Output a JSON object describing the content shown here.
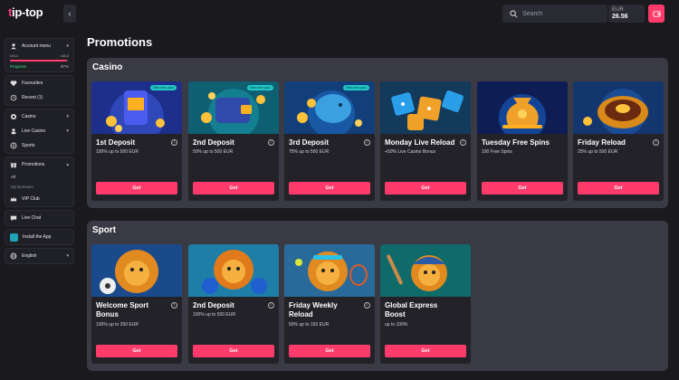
{
  "header": {
    "logo_prefix": "t",
    "logo_rest": "ip-top",
    "back_icon": "chevron-left-icon",
    "search_placeholder": "Search",
    "currency": "EUR",
    "balance": "26.56"
  },
  "sidebar": {
    "account_label": "Account menu",
    "level_from": "LVL1",
    "level_to": "LVL2",
    "progress_label": "Progress",
    "progress_value": "97%",
    "progress_fraction": 0.97,
    "items": [
      {
        "label": "Favourites",
        "icon": "heart-icon"
      },
      {
        "label": "Recent (1)",
        "icon": "clock-icon"
      },
      {
        "label": "Casino",
        "icon": "chip-icon"
      },
      {
        "label": "Live Casino",
        "icon": "dealer-icon"
      },
      {
        "label": "Sports",
        "icon": "ball-icon"
      },
      {
        "label": "Promotions",
        "icon": "gift-icon"
      },
      {
        "label": "VIP Club",
        "icon": "crown-icon"
      },
      {
        "label": "Live Chat",
        "icon": "chat-icon"
      },
      {
        "label": "Install the App",
        "icon": "app-icon"
      },
      {
        "label": "English",
        "icon": "globe-icon"
      }
    ],
    "promo_sub": [
      "All",
      "My Bonuses"
    ]
  },
  "main": {
    "title": "Promotions",
    "casino": {
      "title": "Casino",
      "cards": [
        {
          "title": "1st Deposit",
          "desc": "100% up to 500 EUR",
          "tag": "Welcome pack",
          "button": "Get"
        },
        {
          "title": "2nd Deposit",
          "desc": "50% up to 500 EUR",
          "tag": "Welcome pack",
          "button": "Get"
        },
        {
          "title": "3rd Deposit",
          "desc": "75% up to 500 EUR",
          "tag": "Welcome pack",
          "button": "Get"
        },
        {
          "title": "Monday Live Reload",
          "desc": "+50% Live Casino Bonus",
          "button": "Get"
        },
        {
          "title": "Tuesday Free Spins",
          "desc": "100 Free Spins",
          "button": "Get"
        },
        {
          "title": "Friday Reload",
          "desc": "25% up to 500 EUR",
          "button": "Get"
        }
      ]
    },
    "sport": {
      "title": "Sport",
      "cards": [
        {
          "title": "Welcome Sport Bonus",
          "desc": "100% up to 250 EUR",
          "button": "Get"
        },
        {
          "title": "2nd Deposit",
          "desc": "100% up to 500 EUR",
          "button": "Get"
        },
        {
          "title": "Friday Weekly Reload",
          "desc": "50% up to 150 EUR",
          "button": "Get"
        },
        {
          "title": "Global Express Boost",
          "desc": "up to 100%",
          "button": "Get"
        }
      ]
    }
  },
  "colors": {
    "accent": "#ff3b6b",
    "bg": "#19191e",
    "section": "#3a3a44",
    "card": "#222228",
    "tag": "#21c8c8",
    "progress_label": "#3ce07a"
  }
}
